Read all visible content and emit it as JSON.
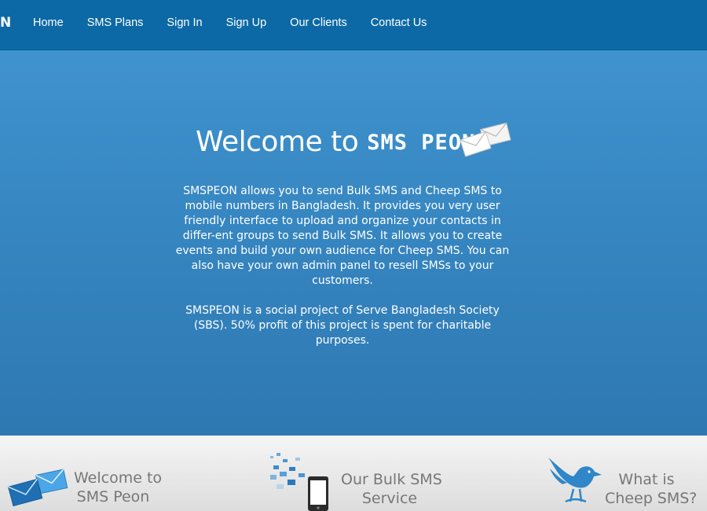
{
  "header": {
    "logo_fragment": "N",
    "nav": [
      "Home",
      "SMS Plans",
      "Sign In",
      "Sign Up",
      "Our Clients",
      "Contact Us"
    ]
  },
  "hero": {
    "title_prefix": "Welcome to",
    "brand": "SMS PEON",
    "paragraph1": "SMSPEON allows you to send Bulk SMS and Cheep SMS to mobile numbers in Bangladesh. It provides you very user friendly interface to upload and organize your contacts in differ-ent groups to send Bulk SMS. It allows you to create events and build your own audience for Cheep SMS. You can also have your own admin panel to resell SMSs to your customers.",
    "paragraph2": "SMSPEON is a social project of Serve Bangladesh Society (SBS). 50% profit of this project is spent for charitable purposes."
  },
  "features": [
    {
      "line1": "Welcome to",
      "line2": "SMS Peon",
      "icon": "envelopes-icon"
    },
    {
      "line1": "Our Bulk SMS",
      "line2": "Service",
      "icon": "phone-messages-icon"
    },
    {
      "line1": "What is",
      "line2": "Cheep SMS?",
      "icon": "bird-icon"
    }
  ],
  "colors": {
    "nav_bg": "#0c69a6",
    "hero_top": "#3f93cf",
    "hero_bottom": "#2e78b2",
    "feature_text": "#777777",
    "icon_blue": "#2f86c8"
  }
}
